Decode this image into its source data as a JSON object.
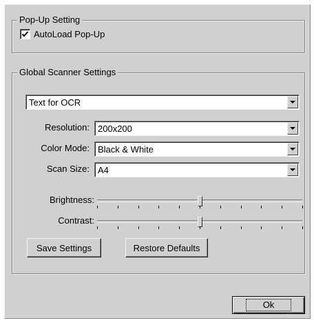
{
  "popup_group": {
    "legend": "Pop-Up Setting",
    "autoload": {
      "label": "AutoLoad Pop-Up",
      "checked": true
    }
  },
  "scanner_group": {
    "legend": "Global Scanner Settings",
    "profile": {
      "value": "Text for OCR"
    },
    "resolution": {
      "label": "Resolution:",
      "value": "200x200"
    },
    "color_mode": {
      "label": "Color Mode:",
      "value": "Black & White"
    },
    "scan_size": {
      "label": "Scan Size:",
      "value": "A4"
    },
    "brightness": {
      "label": "Brightness:",
      "level_percent": 50,
      "ticks": 11
    },
    "contrast": {
      "label": "Contrast:",
      "level_percent": 50,
      "ticks": 11
    },
    "save_label": "Save Settings",
    "restore_label": "Restore Defaults"
  },
  "ok_label": "Ok",
  "icons": {
    "dropdown": "chevron-down-icon",
    "check": "check-icon"
  }
}
